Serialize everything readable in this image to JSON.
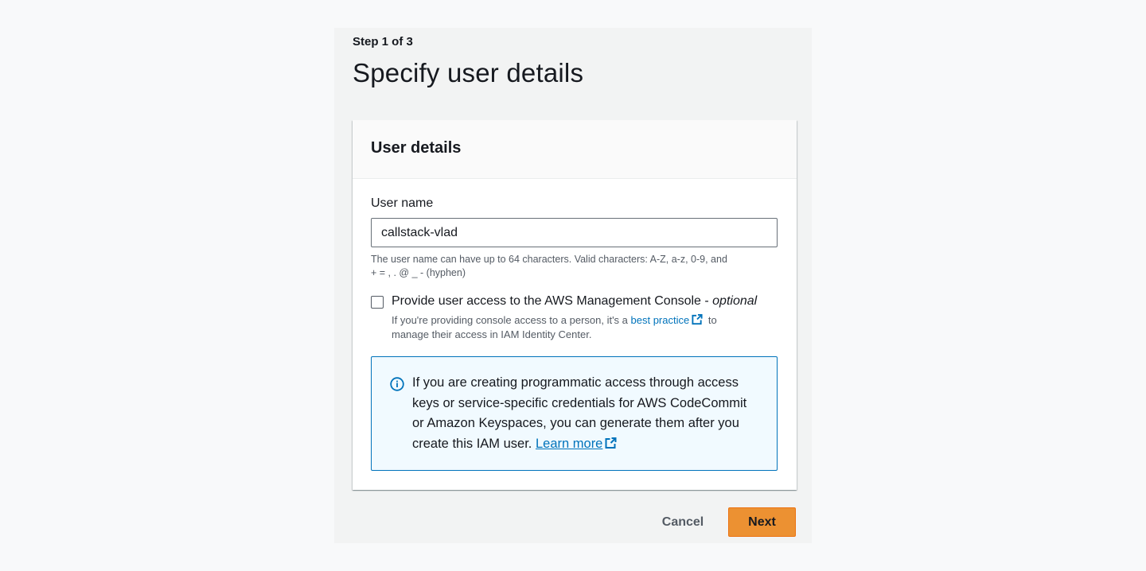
{
  "wizard": {
    "step_label": "Step 1 of 3",
    "title": "Specify user details"
  },
  "card": {
    "header": "User details",
    "username": {
      "label": "User name",
      "value": "callstack-vlad",
      "constraint_line1": "The user name can have up to 64 characters. Valid characters: A-Z, a-z, 0-9, and",
      "constraint_line2": "+ = , . @ _ - (hyphen)"
    },
    "console_access": {
      "checked": false,
      "label": "Provide user access to the AWS Management Console - ",
      "label_optional": "optional",
      "desc_before": "If you're providing console access to a person, it's a ",
      "desc_link": "best practice",
      "desc_after": " to",
      "desc_line2": "manage their access in IAM Identity Center."
    },
    "info": {
      "line1": "If you are creating programmatic access through access",
      "line2": "keys or service-specific credentials for AWS CodeCommit",
      "line3": "or Amazon Keyspaces, you can generate them after you",
      "line4": "create this IAM user. ",
      "learn_more": "Learn more"
    }
  },
  "actions": {
    "cancel": "Cancel",
    "next": "Next"
  },
  "icons": {
    "info": "info-circle-icon",
    "external": "external-link-icon"
  },
  "colors": {
    "primary_button": "#ec9132",
    "link": "#0073bb",
    "info_bg": "#f1faff",
    "info_border": "#0073bb"
  }
}
